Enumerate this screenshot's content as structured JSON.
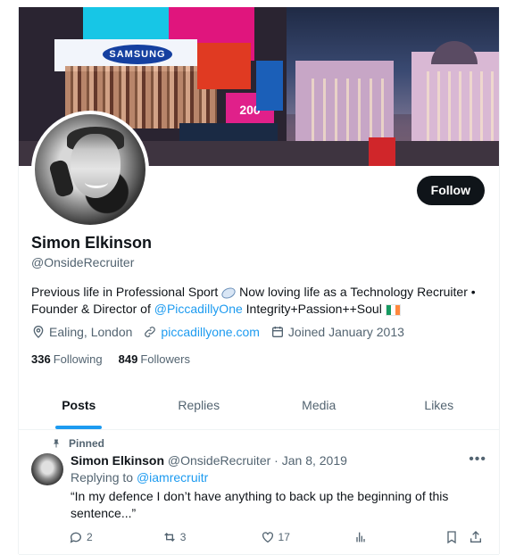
{
  "profile": {
    "name": "Simon Elkinson",
    "handle": "@OnsideRecruiter",
    "follow_label": "Follow",
    "bio": {
      "line1": "Previous life in Professional Sport",
      "line1b": "Now loving life as a Technology Recruiter •",
      "line2a": "Founder & Director of",
      "mention": "@PiccadillyOne",
      "line2b": "Integrity+Passion++Soul"
    },
    "location": "Ealing, London",
    "website": "piccadillyone.com",
    "joined": "Joined January 2013",
    "following_count": "336",
    "following_label": "Following",
    "followers_count": "849",
    "followers_label": "Followers"
  },
  "banner": {
    "samsung_text": "SAMSUNG",
    "billboard_text": "200"
  },
  "tabs": [
    {
      "label": "Posts",
      "active": true
    },
    {
      "label": "Replies",
      "active": false
    },
    {
      "label": "Media",
      "active": false
    },
    {
      "label": "Likes",
      "active": false
    }
  ],
  "pinned_tweet": {
    "pinned_label": "Pinned",
    "author_name": "Simon Elkinson",
    "author_handle": "@OnsideRecruiter",
    "separator": "·",
    "date": "Jan 8, 2019",
    "replying_label": "Replying to",
    "replying_to": "@iamrecruitr",
    "text": "“In my defence I don’t have anything to back up the beginning of this sentence...”",
    "replies": "2",
    "reposts": "3",
    "likes": "17"
  },
  "colors": {
    "accent": "#1d9bf0",
    "text_primary": "#0f1419",
    "text_secondary": "#536471",
    "button_bg": "#0f1419"
  },
  "icons": [
    "location-icon",
    "link-icon",
    "calendar-icon",
    "pin-icon",
    "more-icon",
    "reply-icon",
    "repost-icon",
    "like-icon",
    "views-icon",
    "bookmark-icon",
    "share-icon"
  ]
}
